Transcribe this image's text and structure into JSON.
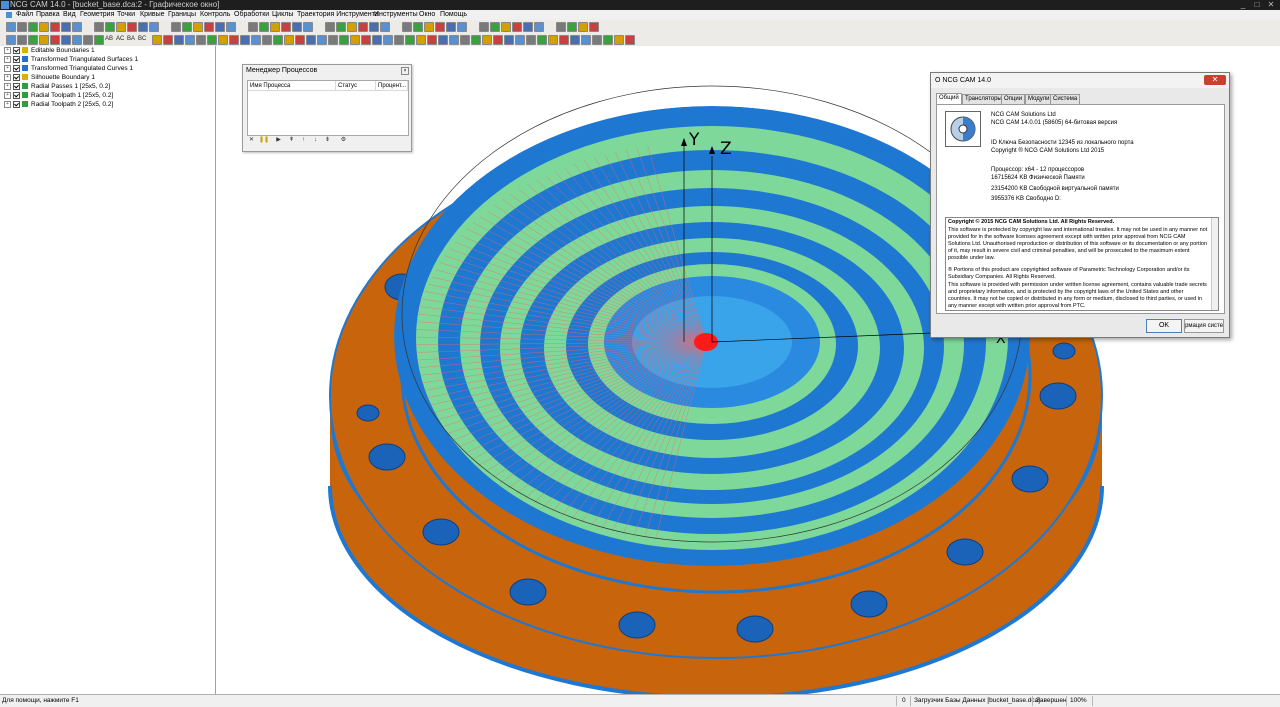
{
  "window": {
    "title": "NCG CAM 14.0 - [bucket_base.dca:2 - Графическое окно]",
    "controls": [
      "_",
      "□",
      "✕"
    ]
  },
  "menu": [
    "Файл",
    "Правка",
    "Вид",
    "Геометрия",
    "Точки",
    "Кривые",
    "Границы",
    "Контроль",
    "Обработки",
    "Циклы",
    "Траектория Инструмента",
    "Инструменты",
    "Окно",
    "Помощь"
  ],
  "toolbar_text": [
    "AB",
    "AC",
    "BA",
    "BC"
  ],
  "tree": {
    "items": [
      {
        "label": "Editable Boundaries 1",
        "color": "#d4b400"
      },
      {
        "label": "Transformed Triangulated Surfaces 1",
        "color": "#2a6fcf"
      },
      {
        "label": "Transformed Triangulated Curves 1",
        "color": "#2a6fcf"
      },
      {
        "label": "Silhouette Boundary 1",
        "color": "#d4b400"
      },
      {
        "label": "Radial Passes 1 [25x5, 0.2]",
        "color": "#2aa040"
      },
      {
        "label": "Radial Toolpath 1 [25x5, 0.2]",
        "color": "#2aa040"
      },
      {
        "label": "Radial Toolpath 2 [25x5, 0.2]",
        "color": "#2aa040"
      }
    ]
  },
  "process_manager": {
    "title": "Менеджер Процессов",
    "columns": [
      "Имя Процесса",
      "Статус",
      "Процент..."
    ]
  },
  "viewport": {
    "axis_y": "Y",
    "axis_z": "Z",
    "axis_x": "X",
    "colors": {
      "orange": "#c8640c",
      "blue": "#1e78d2",
      "green": "#7ed89a",
      "red": "#ff1a1a"
    }
  },
  "about": {
    "title": "О NCG CAM 14.0",
    "tabs": [
      "Общий",
      "Трансляторы",
      "Опции",
      "Модули",
      "Система"
    ],
    "lines_top": [
      "NCG CAM Solutions Ltd",
      "NCG CAM 14.0.01 (58605) 64-битовая версия"
    ],
    "lines_mid": [
      "ID Ключа Безопасности 12345 из локального порта",
      "Copyright ® NCG CAM Solutions Ltd 2015"
    ],
    "lines_sys": [
      "Процессор: x64 - 12 процессоров",
      "16715624 KB Физической Памяти",
      "23154200 KB Свободной виртуальной памяти",
      "3955376 KB Свободно D:"
    ],
    "license_title": "Copyright © 2015 NCG CAM Solutions Ltd. All Rights Reserved.",
    "license_p1": "This software is protected by copyright law and international treaties. It may not be used in any manner not provided for in the software licenses agreement except with written prior approval from NCG CAM Solutions Ltd. Unauthorised reproduction or distribution of this software or its documentation or any portion of it, may result in severe civil and criminal penalties, and will be prosecuted to the maximum extent possible under law.",
    "license_p2": "® Portions of this product are copyrighted software of Parametric Technology Corporation and/or its Subsidiary Companies. All Rights Reserved.",
    "license_p3": "This software is provided with permission under written license agreement, contains valuable trade secrets and proprietary information, and is protected by the copyright laws of the United States and other countries. It may not be copied or distributed in any form or medium, disclosed to third parties, or used in any manner except with written prior approval from PTC.",
    "ok": "OK",
    "sys_btn": "рмация систе"
  },
  "status": {
    "hint": "Для помощи, нажмите F1",
    "count": "0",
    "loader": "Загрузчик Базы Данных [bucket_base.dca]",
    "done": "Завершен",
    "percent": "100%"
  }
}
